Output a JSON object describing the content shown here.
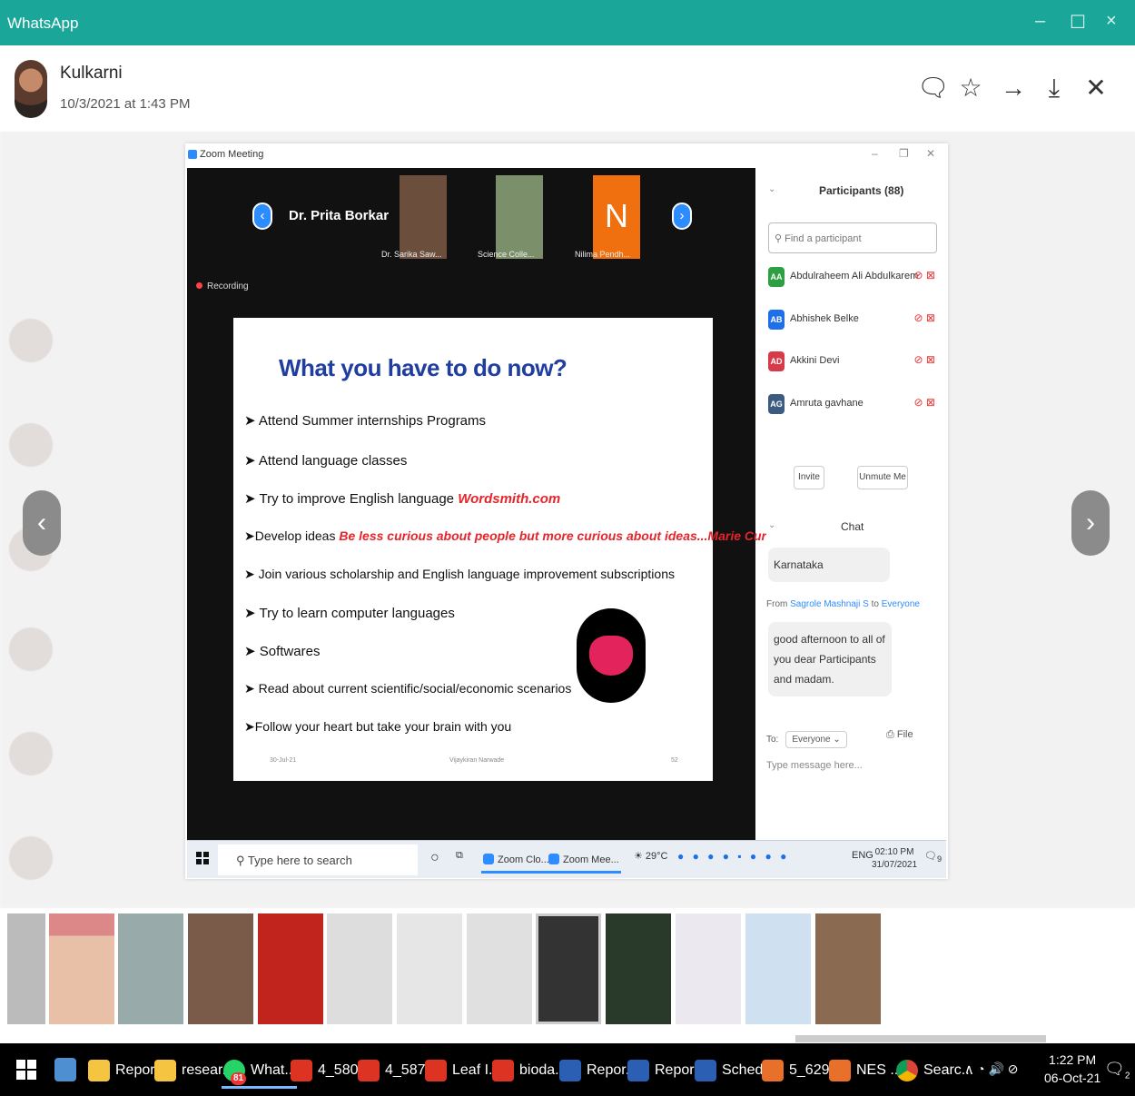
{
  "app": {
    "title": "WhatsApp"
  },
  "viewer": {
    "sender": "Kulkarni",
    "timestamp": "10/3/2021 at 1:43 PM"
  },
  "zoom": {
    "window_title": "Zoom Meeting",
    "active_speaker": "Dr. Prita Borkar",
    "thumbnails": [
      {
        "label": "Dr. Sarika Saw..."
      },
      {
        "label": "Science Colle..."
      },
      {
        "label": "Nilima Pendh..."
      }
    ],
    "thumb_letter": "N",
    "recording": "Recording",
    "slide": {
      "title": "What you have to do now?",
      "bullets": [
        {
          "text": "Attend Summer internships Programs",
          "red": ""
        },
        {
          "text": "Attend language classes",
          "red": ""
        },
        {
          "text": "Try to improve English language ",
          "red": "Wordsmith.com"
        },
        {
          "text": "Develop ideas ",
          "red": "Be less curious about people but more curious about ideas...Marie Curie"
        },
        {
          "text": "Join various scholarship and English language improvement subscriptions",
          "red": ""
        },
        {
          "text": "Try to learn computer languages",
          "red": ""
        },
        {
          "text": "Softwares",
          "red": ""
        },
        {
          "text": "Read about current scientific/social/economic scenarios",
          "red": ""
        },
        {
          "text": "Follow your heart but take your brain with you",
          "red": ""
        }
      ],
      "footer_date": "30-Jul-21",
      "footer_name": "Vijaykiran Narwade",
      "footer_page": "52"
    },
    "participants": {
      "header": "Participants (88)",
      "search_placeholder": "Find a participant",
      "list": [
        {
          "initials": "AA",
          "name": "Abdulraheem Ali Abdulkarem",
          "color": "#2ea043"
        },
        {
          "initials": "AB",
          "name": "Abhishek Belke",
          "color": "#1f6feb"
        },
        {
          "initials": "AD",
          "name": "Akkini Devi",
          "color": "#d73a49"
        },
        {
          "initials": "AG",
          "name": "Amruta gavhane",
          "color": "#3d5a80"
        }
      ],
      "invite": "Invite",
      "unmute": "Unmute Me"
    },
    "chat": {
      "header": "Chat",
      "msg1": "Karnataka",
      "from_prefix": "From ",
      "from_name": "Sagrole Mashnaji S",
      "from_to": " to ",
      "from_target": "Everyone",
      "msg2": "good afternoon to all of you dear Participants and madam.",
      "to_label": "To:",
      "to_value": "Everyone",
      "file": "File",
      "input_placeholder": "Type message here..."
    },
    "inner_taskbar": {
      "search": "Type here to search",
      "app1": "Zoom Clo...",
      "app2": "Zoom Mee...",
      "temp": "29°C",
      "lang": "ENG",
      "time": "02:10 PM",
      "date": "31/07/2021",
      "notif": "9"
    }
  },
  "taskbar": {
    "items": [
      "Report",
      "resear...",
      "What...",
      "4_580...",
      "4_587...",
      "Leaf I...",
      "bioda...",
      "Repor...",
      "Repor...",
      "Sched...",
      "5_629...",
      "NES ...",
      "Searc..."
    ],
    "badge": "81",
    "time": "1:22 PM",
    "date": "06-Oct-21",
    "notif": "2"
  }
}
